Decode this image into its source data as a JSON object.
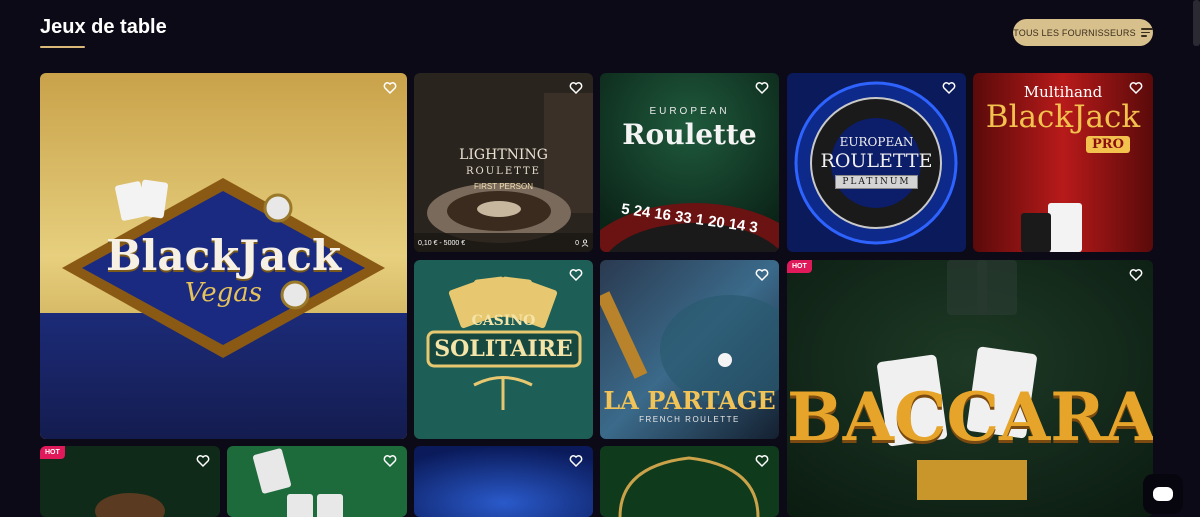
{
  "header": {
    "title": "Jeux de table",
    "providers_label": "TOUS LES FOURNISSEURS"
  },
  "games": {
    "blackjack_vegas": {
      "line1": "BlackJack",
      "line2": "Vegas"
    },
    "lightning_roulette": {
      "line1": "LIGHTNING",
      "line2": "ROULETTE",
      "line3": "FIRST PERSON",
      "limits": "0,10 € - 5000 €",
      "players": "0"
    },
    "european_roulette": {
      "line1": "EUROPEAN",
      "line2": "Roulette",
      "wheel_numbers": "5 24 16 33 1 20 14 3"
    },
    "european_roulette_platinum": {
      "line1": "EUROPEAN",
      "line2": "ROULETTE",
      "line3": "PLATINUM"
    },
    "multihand_blackjack": {
      "line1": "Multihand",
      "line2": "BlackJack",
      "line3": "PRO"
    },
    "casino_solitaire": {
      "line1": "CASINO",
      "line2": "SOLITAIRE"
    },
    "la_partage": {
      "line1": "LA PARTAGE",
      "line2": "FRENCH ROULETTE"
    },
    "baccarat": {
      "hot": "HOT",
      "line1": "BACCARAT"
    },
    "bottom_row": {
      "hot": "HOT"
    }
  },
  "colors": {
    "accent": "#d8c08c",
    "hot": "#e0195a",
    "background": "#0c0a17"
  },
  "icons": {
    "favorite": "heart-outline-icon",
    "filter": "filter-icon",
    "chat": "chat-icon",
    "players": "user-icon"
  }
}
